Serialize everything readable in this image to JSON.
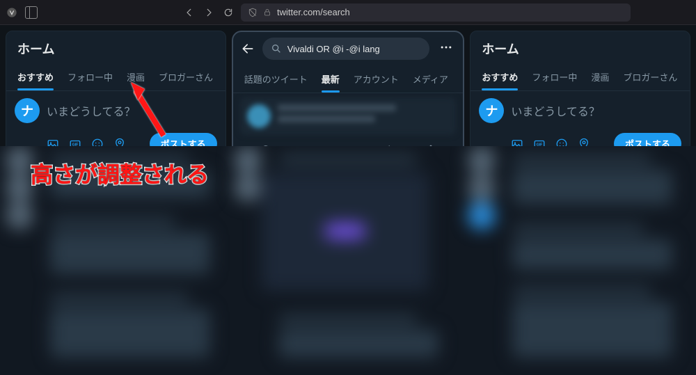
{
  "browser": {
    "url": "twitter.com/search"
  },
  "panels": {
    "home": {
      "title": "ホーム",
      "tabs": [
        "おすすめ",
        "フォロー中",
        "漫画",
        "ブロガーさん"
      ],
      "active_tab": 0,
      "avatar_letter": "ナ",
      "compose_placeholder": "いまどうしてる？",
      "post_button": "ポストする"
    },
    "search": {
      "query": "Vivaldi OR @i -@i lang",
      "tabs": [
        "話題のツイート",
        "最新",
        "アカウント",
        "メディア"
      ],
      "active_tab": 1
    }
  },
  "overlay_text": "高さが調整される",
  "colors": {
    "accent": "#1d9bf0",
    "bg": "#15202b",
    "annotation": "#ff1515"
  }
}
